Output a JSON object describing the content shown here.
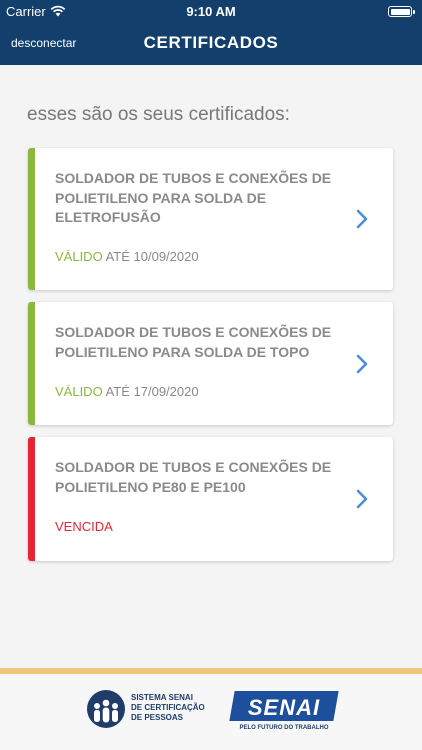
{
  "status_bar": {
    "carrier": "Carrier",
    "time": "9:10 AM"
  },
  "header": {
    "logout_label": "desconectar",
    "title": "CERTIFICADOS"
  },
  "intro": "esses são os seus certificados:",
  "certificates": [
    {
      "title": "SOLDADOR DE TUBOS E CONEXÕES DE POLIETILENO PARA SOLDA DE ELETROFUSÃO",
      "status_a": "VÁLIDO",
      "status_b": "ATÉ 10/09/2020",
      "bar_color": "#8cb73e"
    },
    {
      "title": "SOLDADOR DE TUBOS E CONEXÕES DE POLIETILENO PARA SOLDA DE TOPO",
      "status_a": "VÁLIDO",
      "status_b": "ATÉ 17/09/2020",
      "bar_color": "#8cb73e"
    },
    {
      "title": "SOLDADOR DE TUBOS E CONEXÕES DE POLIETILENO PE80 E PE100",
      "status": "VENCIDA",
      "bar_color": "#e22636"
    }
  ],
  "footer": {
    "cert_logo_lines": [
      "SISTEMA SENAI",
      "DE CERTIFICAÇÃO",
      "DE PESSOAS"
    ],
    "senai_logo": "SENAI",
    "senai_slogan": "PELO FUTURO DO TRABALHO"
  },
  "colors": {
    "header": "#123f6c",
    "valid": "#8cb73e",
    "expired": "#e22636",
    "chevron": "#4a8fd6",
    "footer_accent": "#f0c77c"
  }
}
